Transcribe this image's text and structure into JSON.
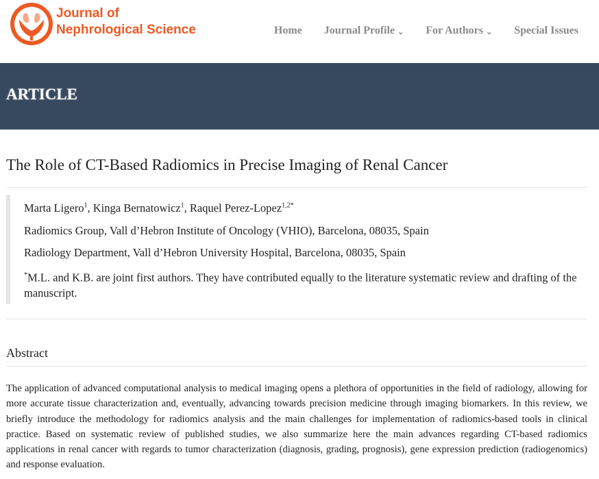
{
  "brand": {
    "line1": "Journal of",
    "line2": "Nephrological Science",
    "color": "#ee5a24"
  },
  "nav": [
    {
      "label": "Home",
      "dropdown": false
    },
    {
      "label": "Journal Profile",
      "dropdown": true
    },
    {
      "label": "For Authors",
      "dropdown": true
    },
    {
      "label": "Special Issues",
      "dropdown": false
    }
  ],
  "banner": {
    "label": "ARTICLE",
    "bg": "#36495e"
  },
  "article": {
    "title": "The Role of CT-Based Radiomics in Precise Imaging of Renal Cancer",
    "authors": [
      {
        "name": "Marta Ligero",
        "sup": "1",
        "sep": ", "
      },
      {
        "name": "Kinga Bernatowicz",
        "sup": "1",
        "sep": ", "
      },
      {
        "name": "Raquel Perez-Lopez",
        "sup": "1,2*",
        "sep": ""
      }
    ],
    "affiliation1": "Radiomics Group, Vall d’Hebron Institute of Oncology (VHIO), Barcelona, 08035, Spain",
    "affiliation2": "Radiology Department, Vall d’Hebron University Hospital, Barcelona, 08035, Spain",
    "note_mark": "*",
    "note": "M.L. and K.B. are joint first authors. They have contributed equally to the literature systematic review and drafting of the manuscript.",
    "abstract_heading": "Abstract",
    "abstract": "The application of advanced computational analysis to medical imaging opens a plethora of opportunities in the field of radiology, allowing for more accurate tissue characterization and, eventually, advancing towards precision medicine through imaging biomarkers. In this review, we briefly introduce the methodology for radiomics analysis and the main challenges for implementation of radiomics-based tools in clinical practice. Based on systematic review of published studies, we also summarize here the main advances regarding CT-based radiomics applications in renal cancer with regards to tumor characterization (diagnosis, grading, prognosis), gene expression prediction (radiogenomics) and response evaluation."
  },
  "icons": {
    "logo": "kidney-hands-logo",
    "dropdown": "chevron-down-icon"
  }
}
